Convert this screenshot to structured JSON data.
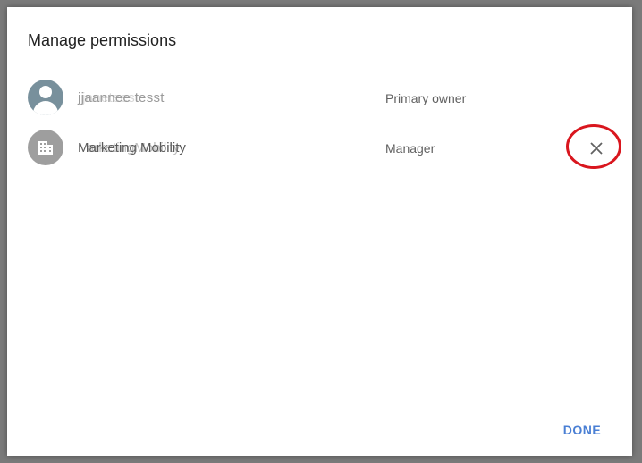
{
  "dialog": {
    "title": "Manage permissions",
    "done_label": "DONE"
  },
  "permissions": [
    {
      "name": "jjaannee tesst",
      "name_overlay": "janeteest",
      "role": "Primary owner",
      "avatar_icon": "person-icon",
      "removable": false
    },
    {
      "name": "Marketing Mobility",
      "name_overlay": "arketingMobility",
      "role": "Manager",
      "avatar_icon": "domain-icon",
      "removable": true
    }
  ],
  "colors": {
    "accent": "#4a7fd4",
    "highlight": "#d9161e",
    "user_avatar": "#78909c",
    "group_avatar": "#9e9e9e"
  },
  "icons": {
    "remove": "close-icon"
  }
}
